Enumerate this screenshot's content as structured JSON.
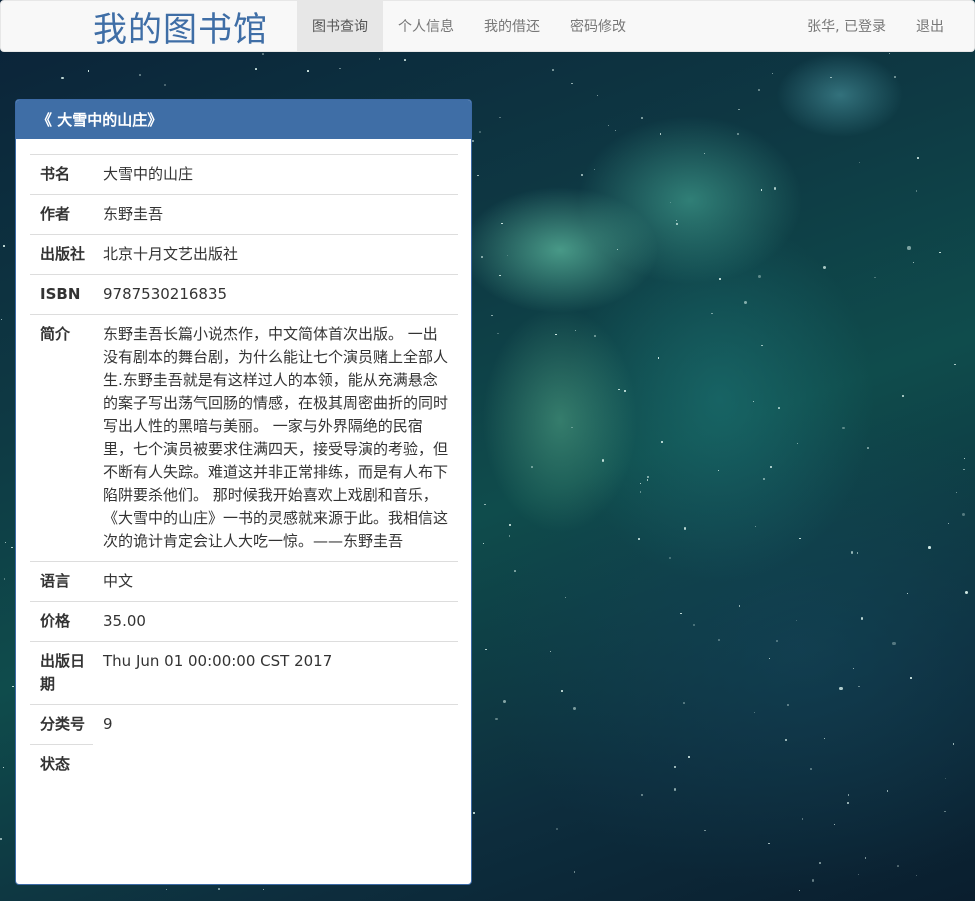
{
  "navbar": {
    "brand": "我的图书馆",
    "items": [
      {
        "label": "图书查询",
        "active": true
      },
      {
        "label": "个人信息",
        "active": false
      },
      {
        "label": "我的借还",
        "active": false
      },
      {
        "label": "密码修改",
        "active": false
      }
    ],
    "user_status": "张华, 已登录",
    "logout": "退出"
  },
  "panel": {
    "title": "《 大雪中的山庄》",
    "fields": [
      {
        "label": "书名",
        "value": "大雪中的山庄"
      },
      {
        "label": "作者",
        "value": "东野圭吾"
      },
      {
        "label": "出版社",
        "value": "北京十月文艺出版社"
      },
      {
        "label": "ISBN",
        "value": "9787530216835"
      },
      {
        "label": "简介",
        "value": "东野圭吾长篇小说杰作，中文简体首次出版。 一出没有剧本的舞台剧，为什么能让七个演员赌上全部人生.东野圭吾就是有这样过人的本领，能从充满悬念的案子写出荡气回肠的情感，在极其周密曲折的同时写出人性的黑暗与美丽。 一家与外界隔绝的民宿里，七个演员被要求住满四天，接受导演的考验，但不断有人失踪。难道这并非正常排练，而是有人布下陷阱要杀他们。 那时候我开始喜欢上戏剧和音乐，《大雪中的山庄》一书的灵感就来源于此。我相信这次的诡计肯定会让人大吃一惊。——东野圭吾"
      },
      {
        "label": "语言",
        "value": "中文"
      },
      {
        "label": "价格",
        "value": "35.00"
      },
      {
        "label": "出版日期",
        "value": "Thu Jun 01 00:00:00 CST 2017"
      },
      {
        "label": "分类号",
        "value": "9"
      },
      {
        "label": "状态",
        "value": ""
      }
    ]
  }
}
